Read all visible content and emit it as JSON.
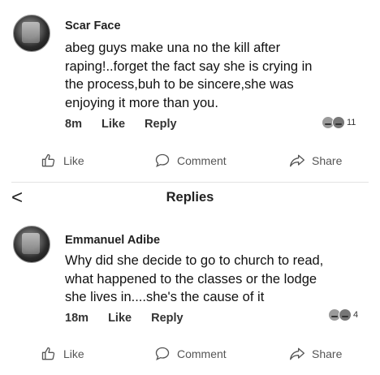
{
  "comments": [
    {
      "author": "Scar Face",
      "text": "abeg guys make una no the kill after\nraping!..forget the fact say she is crying in\nthe process,buh to be sincere,she was\nenjoying it more than you.",
      "time": "8m",
      "like_label": "Like",
      "reply_label": "Reply",
      "reaction_count": "11"
    },
    {
      "author": "Emmanuel Adibe",
      "text": "Why did she decide to go to church to read,\nwhat happened to the classes or the lodge\nshe lives in....she's the cause of it",
      "time": "18m",
      "like_label": "Like",
      "reply_label": "Reply",
      "reaction_count": "4"
    }
  ],
  "actions": [
    {
      "like": "Like",
      "comment": "Comment",
      "share": "Share"
    },
    {
      "like": "Like",
      "comment": "Comment",
      "share": "Share"
    }
  ],
  "replies_header": {
    "back_glyph": "<",
    "title": "Replies"
  },
  "icons": {
    "like": "thumbs-up-icon",
    "comment": "speech-bubble-icon",
    "share": "share-arrow-icon",
    "back": "chevron-left-icon"
  }
}
